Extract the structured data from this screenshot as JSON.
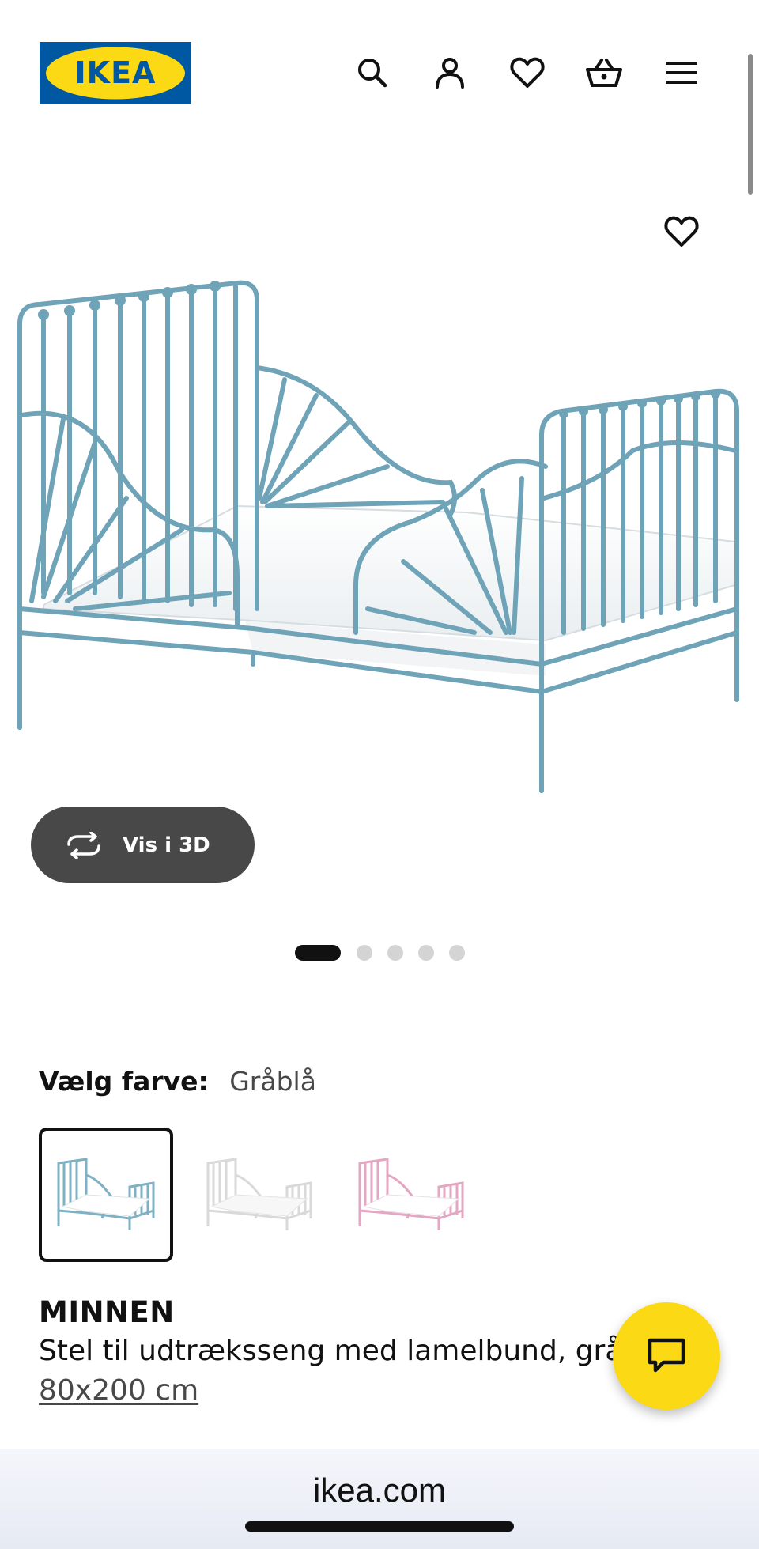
{
  "header": {
    "logo_text": "IKEA",
    "brand_colors": {
      "blue": "#0058a3",
      "yellow": "#fbd914"
    },
    "icons": [
      "search-icon",
      "account-icon",
      "heart-icon",
      "basket-icon",
      "menu-icon"
    ]
  },
  "gallery": {
    "view_3d_label": "Vis i 3D",
    "image_count": 5,
    "active_index": 0,
    "product_color": "#7fb1c4"
  },
  "color_selector": {
    "label": "Vælg farve:",
    "selected_value": "Gråblå",
    "swatches": [
      {
        "name": "Gråblå",
        "color": "#7fb1c4",
        "selected": true
      },
      {
        "name": "white",
        "color": "#e2e2e2",
        "selected": false
      },
      {
        "name": "pink",
        "color": "#e3a6c3",
        "selected": false
      }
    ]
  },
  "product": {
    "name": "MINNEN",
    "description": "Stel til udtræksseng med lamelbund, gråblå",
    "size": "80x200 cm"
  },
  "browser": {
    "url": "ikea.com"
  }
}
